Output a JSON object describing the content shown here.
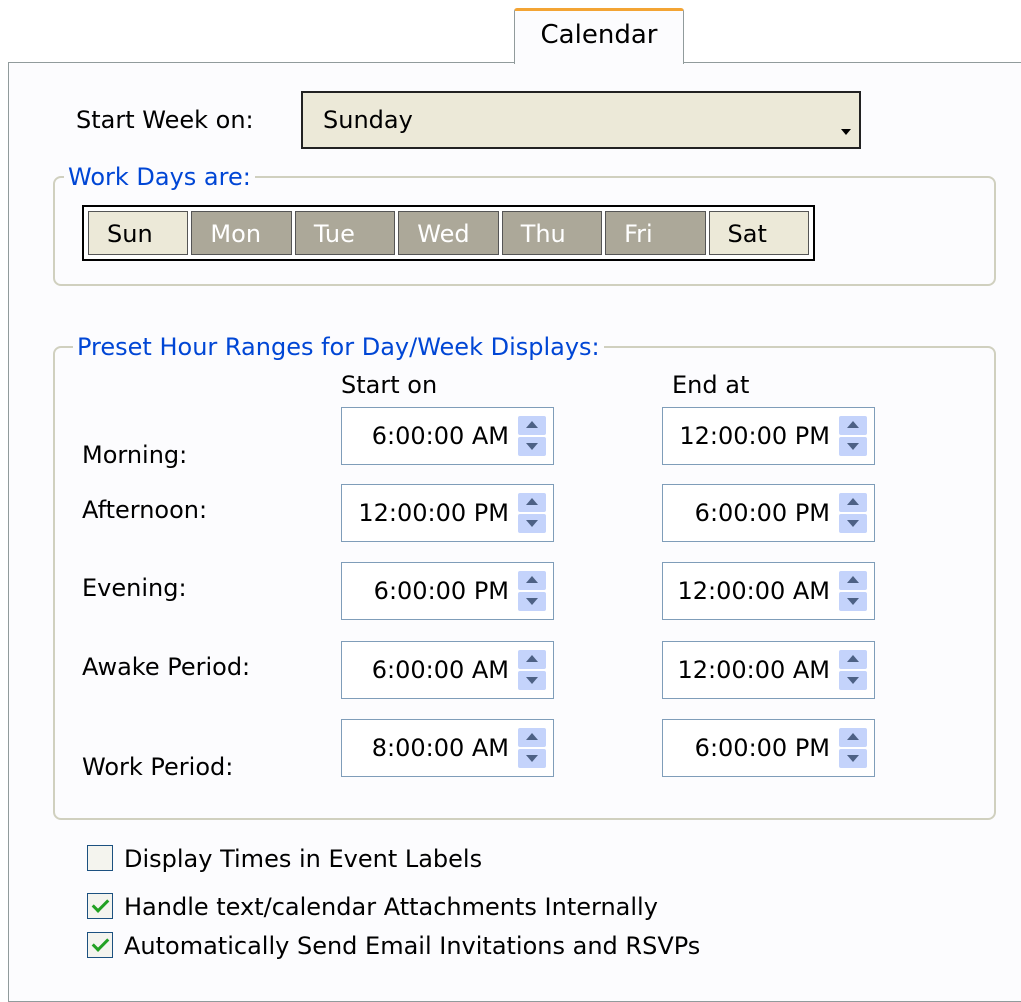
{
  "tab": {
    "label": "Calendar"
  },
  "start_week": {
    "label": "Start Week on:",
    "value": "Sunday"
  },
  "work_days": {
    "legend": "Work Days are:",
    "days": [
      {
        "label": "Sun",
        "selected": false
      },
      {
        "label": "Mon",
        "selected": true
      },
      {
        "label": "Tue",
        "selected": true
      },
      {
        "label": "Wed",
        "selected": true
      },
      {
        "label": "Thu",
        "selected": true
      },
      {
        "label": "Fri",
        "selected": true
      },
      {
        "label": "Sat",
        "selected": false
      }
    ]
  },
  "hour_ranges": {
    "legend": "Preset Hour Ranges for Day/Week Displays:",
    "start_header": "Start on",
    "end_header": "End at",
    "rows": [
      {
        "label": "Morning:",
        "start": "6:00:00 AM",
        "end": "12:00:00 PM"
      },
      {
        "label": "Afternoon:",
        "start": "12:00:00 PM",
        "end": "6:00:00 PM"
      },
      {
        "label": "Evening:",
        "start": "6:00:00 PM",
        "end": "12:00:00 AM"
      },
      {
        "label": "Awake Period:",
        "start": "6:00:00 AM",
        "end": "12:00:00 AM"
      },
      {
        "label": "Work Period:",
        "start": "8:00:00 AM",
        "end": "6:00:00 PM"
      }
    ]
  },
  "options": [
    {
      "label": "Display Times in Event Labels",
      "checked": false
    },
    {
      "label": "Handle text/calendar Attachments Internally",
      "checked": true
    },
    {
      "label": "Automatically Send Email Invitations and RSVPs",
      "checked": true
    }
  ]
}
